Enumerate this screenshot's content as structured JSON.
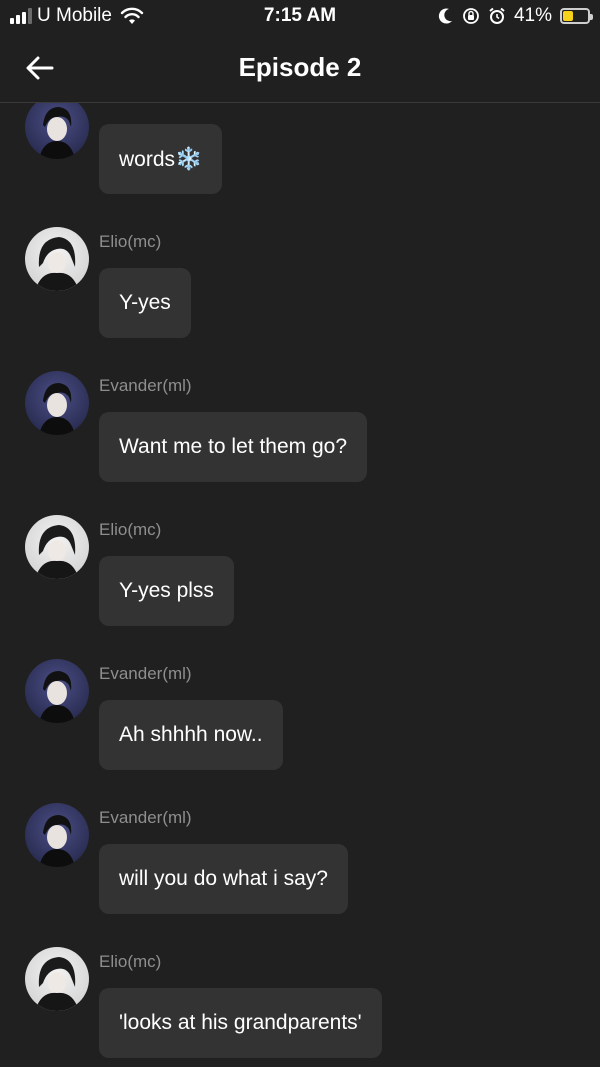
{
  "status": {
    "carrier": "U Mobile",
    "time": "7:15 AM",
    "battery_text": "41%",
    "battery_level": 0.41,
    "battery_color": "#f7d21c"
  },
  "header": {
    "title": "Episode 2"
  },
  "messages": [
    {
      "sender": "",
      "avatar": "evander-avatar",
      "text": "words",
      "emoji": "❄️"
    },
    {
      "sender": "Elio(mc)",
      "avatar": "elio-avatar",
      "text": "Y-yes"
    },
    {
      "sender": "Evander(ml)",
      "avatar": "evander-avatar",
      "text": "Want me to let them go?"
    },
    {
      "sender": "Elio(mc)",
      "avatar": "elio-avatar",
      "text": "Y-yes plss"
    },
    {
      "sender": "Evander(ml)",
      "avatar": "evander-avatar",
      "text": "Ah shhhh now.."
    },
    {
      "sender": "Evander(ml)",
      "avatar": "evander-avatar",
      "text": "will you do what i say?"
    },
    {
      "sender": "Elio(mc)",
      "avatar": "elio-avatar",
      "text": "'looks at his grandparents'"
    }
  ]
}
